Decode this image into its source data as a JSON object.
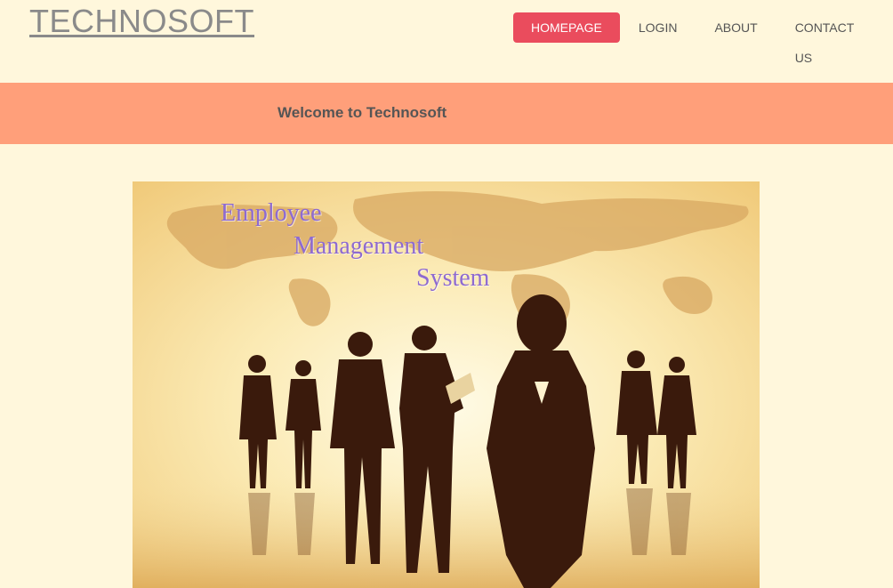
{
  "brand": {
    "name": "TECHNOSOFT"
  },
  "nav": {
    "items": [
      {
        "label": "HOMEPAGE",
        "active": true
      },
      {
        "label": "LOGIN",
        "active": false
      },
      {
        "label": "ABOUT",
        "active": false
      },
      {
        "label": "CONTACT US",
        "active": false
      }
    ]
  },
  "banner": {
    "text": "Welcome to Technosoft"
  },
  "hero": {
    "caption_lines": [
      "Employee",
      "Management",
      "System"
    ]
  },
  "colors": {
    "background": "#fff7dc",
    "banner": "#ff9f7a",
    "nav_active": "#ea4c5d",
    "text": "#555555",
    "caption": "#8e6ad0"
  }
}
